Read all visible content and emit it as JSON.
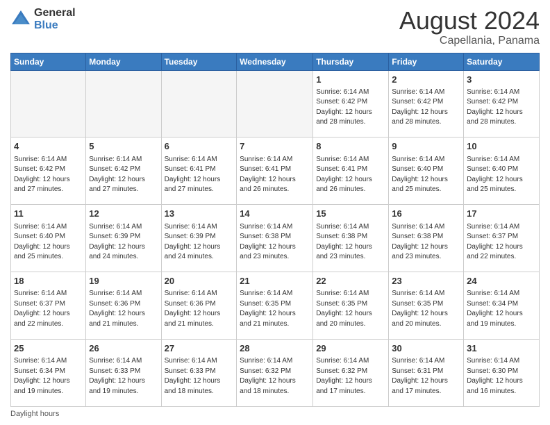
{
  "header": {
    "logo_general": "General",
    "logo_blue": "Blue",
    "month_year": "August 2024",
    "location": "Capellania, Panama"
  },
  "footer": {
    "daylight_hours": "Daylight hours"
  },
  "days_of_week": [
    "Sunday",
    "Monday",
    "Tuesday",
    "Wednesday",
    "Thursday",
    "Friday",
    "Saturday"
  ],
  "weeks": [
    [
      {
        "day": "",
        "info": ""
      },
      {
        "day": "",
        "info": ""
      },
      {
        "day": "",
        "info": ""
      },
      {
        "day": "",
        "info": ""
      },
      {
        "day": "1",
        "info": "Sunrise: 6:14 AM\nSunset: 6:42 PM\nDaylight: 12 hours\nand 28 minutes."
      },
      {
        "day": "2",
        "info": "Sunrise: 6:14 AM\nSunset: 6:42 PM\nDaylight: 12 hours\nand 28 minutes."
      },
      {
        "day": "3",
        "info": "Sunrise: 6:14 AM\nSunset: 6:42 PM\nDaylight: 12 hours\nand 28 minutes."
      }
    ],
    [
      {
        "day": "4",
        "info": "Sunrise: 6:14 AM\nSunset: 6:42 PM\nDaylight: 12 hours\nand 27 minutes."
      },
      {
        "day": "5",
        "info": "Sunrise: 6:14 AM\nSunset: 6:42 PM\nDaylight: 12 hours\nand 27 minutes."
      },
      {
        "day": "6",
        "info": "Sunrise: 6:14 AM\nSunset: 6:41 PM\nDaylight: 12 hours\nand 27 minutes."
      },
      {
        "day": "7",
        "info": "Sunrise: 6:14 AM\nSunset: 6:41 PM\nDaylight: 12 hours\nand 26 minutes."
      },
      {
        "day": "8",
        "info": "Sunrise: 6:14 AM\nSunset: 6:41 PM\nDaylight: 12 hours\nand 26 minutes."
      },
      {
        "day": "9",
        "info": "Sunrise: 6:14 AM\nSunset: 6:40 PM\nDaylight: 12 hours\nand 25 minutes."
      },
      {
        "day": "10",
        "info": "Sunrise: 6:14 AM\nSunset: 6:40 PM\nDaylight: 12 hours\nand 25 minutes."
      }
    ],
    [
      {
        "day": "11",
        "info": "Sunrise: 6:14 AM\nSunset: 6:40 PM\nDaylight: 12 hours\nand 25 minutes."
      },
      {
        "day": "12",
        "info": "Sunrise: 6:14 AM\nSunset: 6:39 PM\nDaylight: 12 hours\nand 24 minutes."
      },
      {
        "day": "13",
        "info": "Sunrise: 6:14 AM\nSunset: 6:39 PM\nDaylight: 12 hours\nand 24 minutes."
      },
      {
        "day": "14",
        "info": "Sunrise: 6:14 AM\nSunset: 6:38 PM\nDaylight: 12 hours\nand 23 minutes."
      },
      {
        "day": "15",
        "info": "Sunrise: 6:14 AM\nSunset: 6:38 PM\nDaylight: 12 hours\nand 23 minutes."
      },
      {
        "day": "16",
        "info": "Sunrise: 6:14 AM\nSunset: 6:38 PM\nDaylight: 12 hours\nand 23 minutes."
      },
      {
        "day": "17",
        "info": "Sunrise: 6:14 AM\nSunset: 6:37 PM\nDaylight: 12 hours\nand 22 minutes."
      }
    ],
    [
      {
        "day": "18",
        "info": "Sunrise: 6:14 AM\nSunset: 6:37 PM\nDaylight: 12 hours\nand 22 minutes."
      },
      {
        "day": "19",
        "info": "Sunrise: 6:14 AM\nSunset: 6:36 PM\nDaylight: 12 hours\nand 21 minutes."
      },
      {
        "day": "20",
        "info": "Sunrise: 6:14 AM\nSunset: 6:36 PM\nDaylight: 12 hours\nand 21 minutes."
      },
      {
        "day": "21",
        "info": "Sunrise: 6:14 AM\nSunset: 6:35 PM\nDaylight: 12 hours\nand 21 minutes."
      },
      {
        "day": "22",
        "info": "Sunrise: 6:14 AM\nSunset: 6:35 PM\nDaylight: 12 hours\nand 20 minutes."
      },
      {
        "day": "23",
        "info": "Sunrise: 6:14 AM\nSunset: 6:35 PM\nDaylight: 12 hours\nand 20 minutes."
      },
      {
        "day": "24",
        "info": "Sunrise: 6:14 AM\nSunset: 6:34 PM\nDaylight: 12 hours\nand 19 minutes."
      }
    ],
    [
      {
        "day": "25",
        "info": "Sunrise: 6:14 AM\nSunset: 6:34 PM\nDaylight: 12 hours\nand 19 minutes."
      },
      {
        "day": "26",
        "info": "Sunrise: 6:14 AM\nSunset: 6:33 PM\nDaylight: 12 hours\nand 19 minutes."
      },
      {
        "day": "27",
        "info": "Sunrise: 6:14 AM\nSunset: 6:33 PM\nDaylight: 12 hours\nand 18 minutes."
      },
      {
        "day": "28",
        "info": "Sunrise: 6:14 AM\nSunset: 6:32 PM\nDaylight: 12 hours\nand 18 minutes."
      },
      {
        "day": "29",
        "info": "Sunrise: 6:14 AM\nSunset: 6:32 PM\nDaylight: 12 hours\nand 17 minutes."
      },
      {
        "day": "30",
        "info": "Sunrise: 6:14 AM\nSunset: 6:31 PM\nDaylight: 12 hours\nand 17 minutes."
      },
      {
        "day": "31",
        "info": "Sunrise: 6:14 AM\nSunset: 6:30 PM\nDaylight: 12 hours\nand 16 minutes."
      }
    ]
  ]
}
